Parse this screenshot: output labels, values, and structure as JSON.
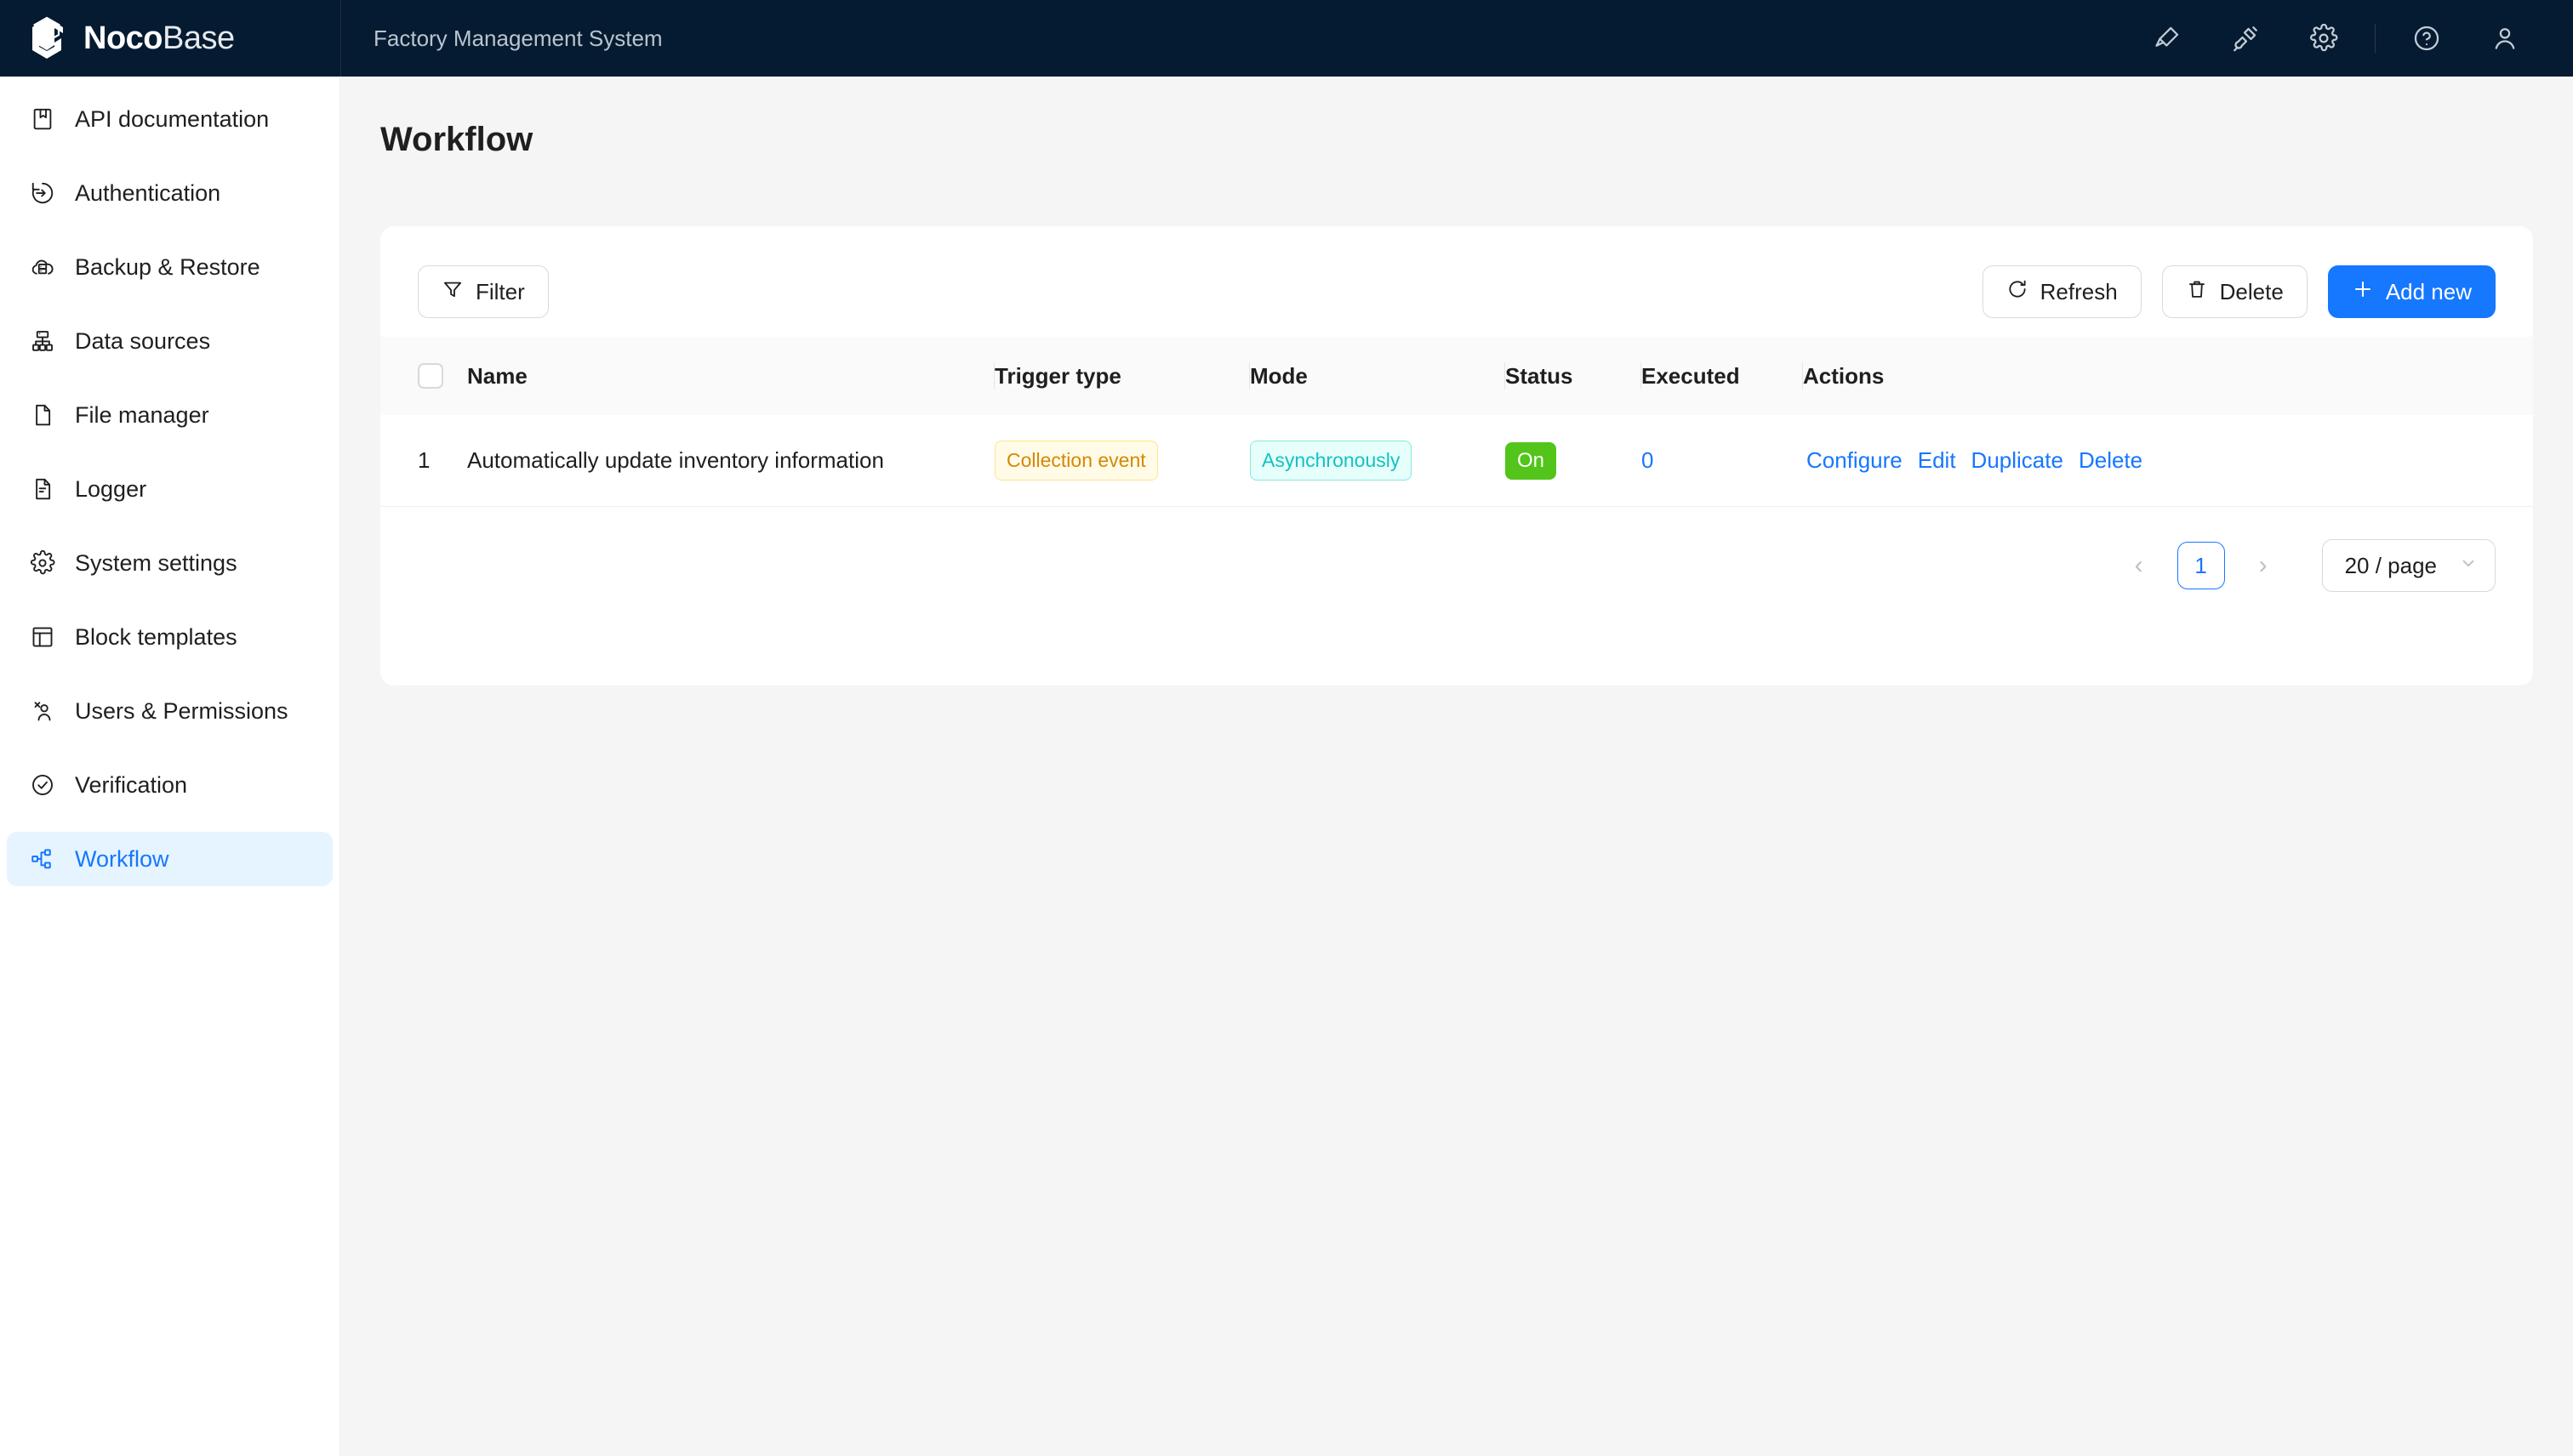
{
  "brand": {
    "name_bold": "Noco",
    "name_light": "Base",
    "logo_icon": "nocobase-cube-logo"
  },
  "header": {
    "app_title": "Factory Management System",
    "icons": [
      {
        "name": "highlighter-icon",
        "glyph": "highlighter"
      },
      {
        "name": "plugin-icon",
        "glyph": "plugin"
      },
      {
        "name": "gear-icon",
        "glyph": "gear"
      },
      {
        "name": "help-icon",
        "glyph": "help"
      },
      {
        "name": "user-avatar-icon",
        "glyph": "user"
      }
    ]
  },
  "sidebar": {
    "items": [
      {
        "label": "API documentation",
        "icon": "book-icon",
        "active": false
      },
      {
        "label": "Authentication",
        "icon": "login-arrow-icon",
        "active": false
      },
      {
        "label": "Backup & Restore",
        "icon": "cloud-server-icon",
        "active": false
      },
      {
        "label": "Data sources",
        "icon": "sitemap-icon",
        "active": false
      },
      {
        "label": "File manager",
        "icon": "file-icon",
        "active": false
      },
      {
        "label": "Logger",
        "icon": "file-text-icon",
        "active": false
      },
      {
        "label": "System settings",
        "icon": "gear-icon",
        "active": false
      },
      {
        "label": "Block templates",
        "icon": "layout-icon",
        "active": false
      },
      {
        "label": "Users & Permissions",
        "icon": "users-icon",
        "active": false
      },
      {
        "label": "Verification",
        "icon": "check-circle-icon",
        "active": false
      },
      {
        "label": "Workflow",
        "icon": "workflow-nodes-icon",
        "active": true
      }
    ]
  },
  "main": {
    "page_title": "Workflow",
    "toolbar": {
      "filter_label": "Filter",
      "refresh_label": "Refresh",
      "delete_label": "Delete",
      "add_new_label": "Add new"
    },
    "table": {
      "columns": [
        "Name",
        "Trigger type",
        "Mode",
        "Status",
        "Executed",
        "Actions"
      ],
      "rows": [
        {
          "index": "1",
          "name": "Automatically update inventory information",
          "trigger_type": "Collection event",
          "mode": "Asynchronously",
          "status": "On",
          "executed": "0",
          "actions": [
            "Configure",
            "Edit",
            "Duplicate",
            "Delete"
          ]
        }
      ]
    },
    "pagination": {
      "prev": "‹",
      "current_page": "1",
      "next": "›",
      "page_size": "20 / page"
    }
  },
  "colors": {
    "header_bg": "#051b31",
    "accent": "#1677ff",
    "active_nav_bg": "#e6f4ff",
    "tag_gold_text": "#d48806",
    "tag_gold_bg": "#fffbe6",
    "tag_cyan_text": "#13c2c2",
    "tag_cyan_bg": "#e6fffb",
    "status_on_bg": "#52c41a"
  }
}
